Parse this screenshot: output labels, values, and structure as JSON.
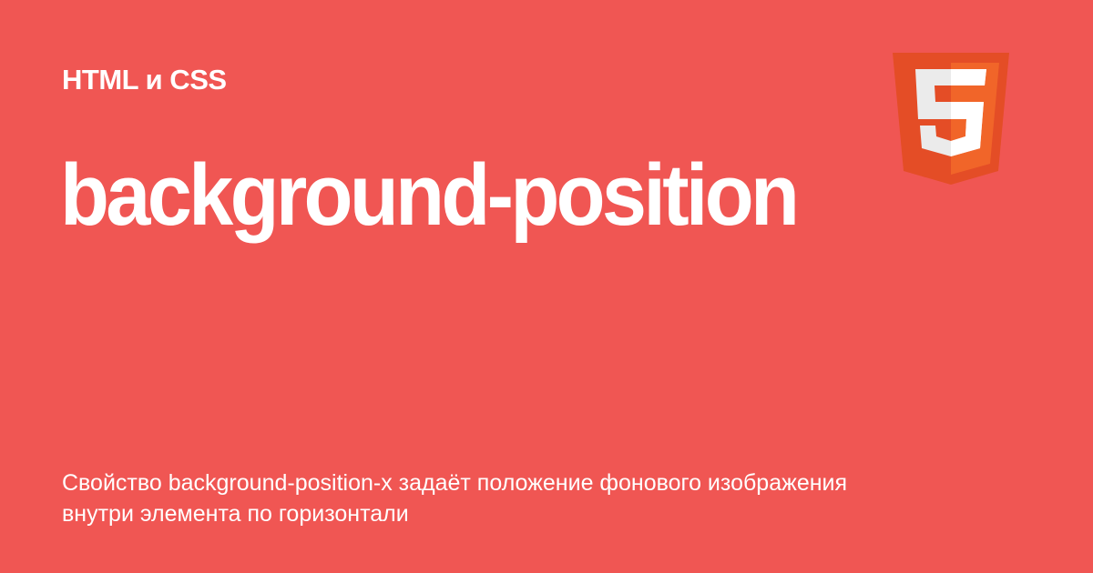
{
  "category": "HTML и CSS",
  "title": "background-position",
  "description": "Свойство background-position-x задаёт положение фонового изображения внутри элемента по горизонтали",
  "logo": {
    "name": "html5-logo",
    "text": "5"
  },
  "colors": {
    "background": "#f05653",
    "logo_dark": "#e44d26",
    "logo_light": "#f16529",
    "logo_five": "#ebebeb"
  }
}
